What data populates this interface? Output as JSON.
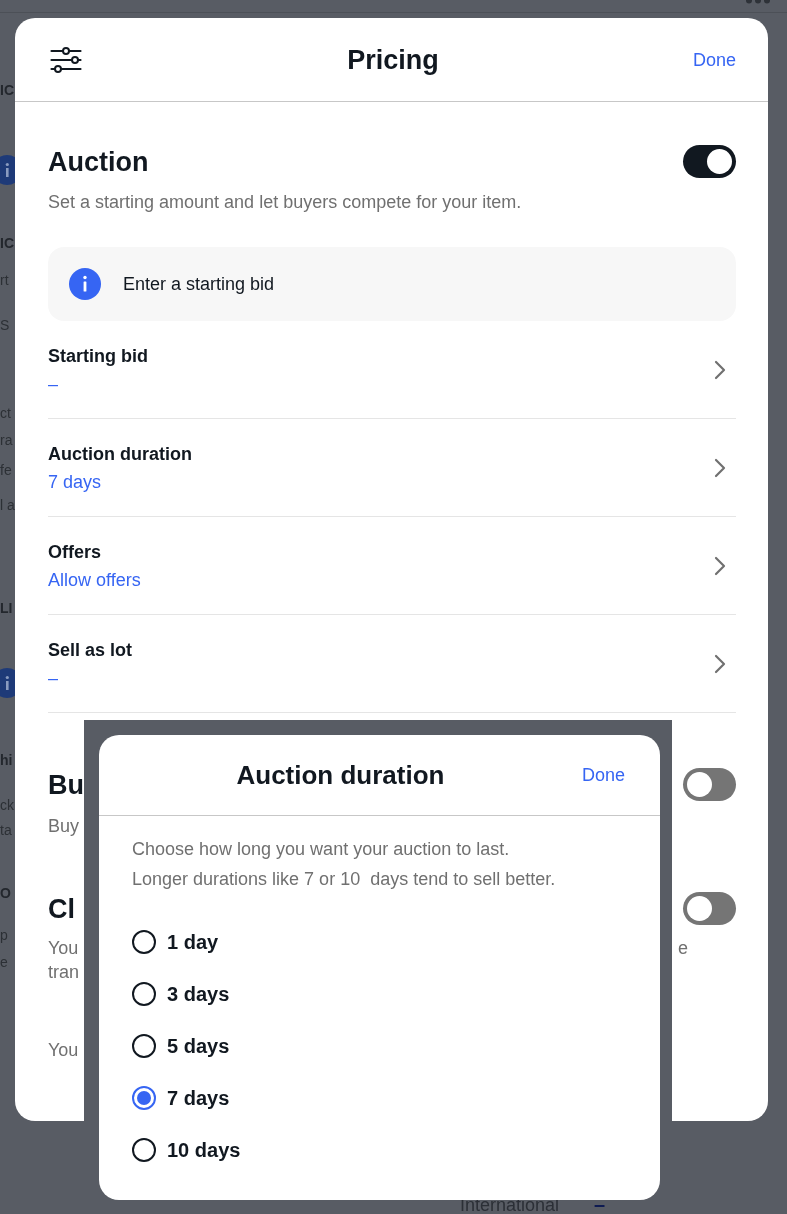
{
  "background": {
    "fragments": [
      {
        "kind": "heading",
        "text": "IC"
      },
      {
        "kind": "info"
      },
      {
        "kind": "heading",
        "text": "IC"
      },
      {
        "kind": "text",
        "text": "rt"
      },
      {
        "kind": "text",
        "text": "S"
      },
      {
        "kind": "text",
        "text": "ct"
      },
      {
        "kind": "text",
        "text": "ra"
      },
      {
        "kind": "text",
        "text": "fe"
      },
      {
        "kind": "text",
        "text": "l a"
      },
      {
        "kind": "heading",
        "text": "LI"
      },
      {
        "kind": "info"
      },
      {
        "kind": "heading",
        "text": "hi"
      },
      {
        "kind": "text",
        "text": "ck"
      },
      {
        "kind": "text",
        "text": "ta"
      },
      {
        "kind": "heading",
        "text": "O"
      },
      {
        "kind": "text",
        "text": "p"
      },
      {
        "kind": "text",
        "text": "e"
      }
    ],
    "footer_label": "International",
    "footer_value": "–"
  },
  "pricing_sheet": {
    "title": "Pricing",
    "done": "Done",
    "auction": {
      "title": "Auction",
      "on": true,
      "description": "Set a starting amount and let buyers compete for your item."
    },
    "notice": "Enter a starting bid",
    "rows": [
      {
        "label": "Starting bid",
        "value": "–"
      },
      {
        "label": "Auction duration",
        "value": "7 days"
      },
      {
        "label": "Offers",
        "value": "Allow offers"
      },
      {
        "label": "Sell as lot",
        "value": "–"
      }
    ],
    "sections": [
      {
        "title": "Bu",
        "on": false,
        "lines": [
          "Buy"
        ]
      },
      {
        "title": "Cl",
        "on": false,
        "lines": [
          "You",
          "tran"
        ],
        "line_end": "e",
        "note": "You"
      }
    ]
  },
  "duration_dialog": {
    "title": "Auction duration",
    "done": "Done",
    "description": [
      "Choose how long you want your auction to last.",
      "Longer durations like 7 or 10  days tend to sell better."
    ],
    "options": [
      {
        "label": "1 day",
        "selected": false
      },
      {
        "label": "3 days",
        "selected": false
      },
      {
        "label": "5 days",
        "selected": false
      },
      {
        "label": "7 days",
        "selected": true
      },
      {
        "label": "10 days",
        "selected": false
      }
    ]
  }
}
